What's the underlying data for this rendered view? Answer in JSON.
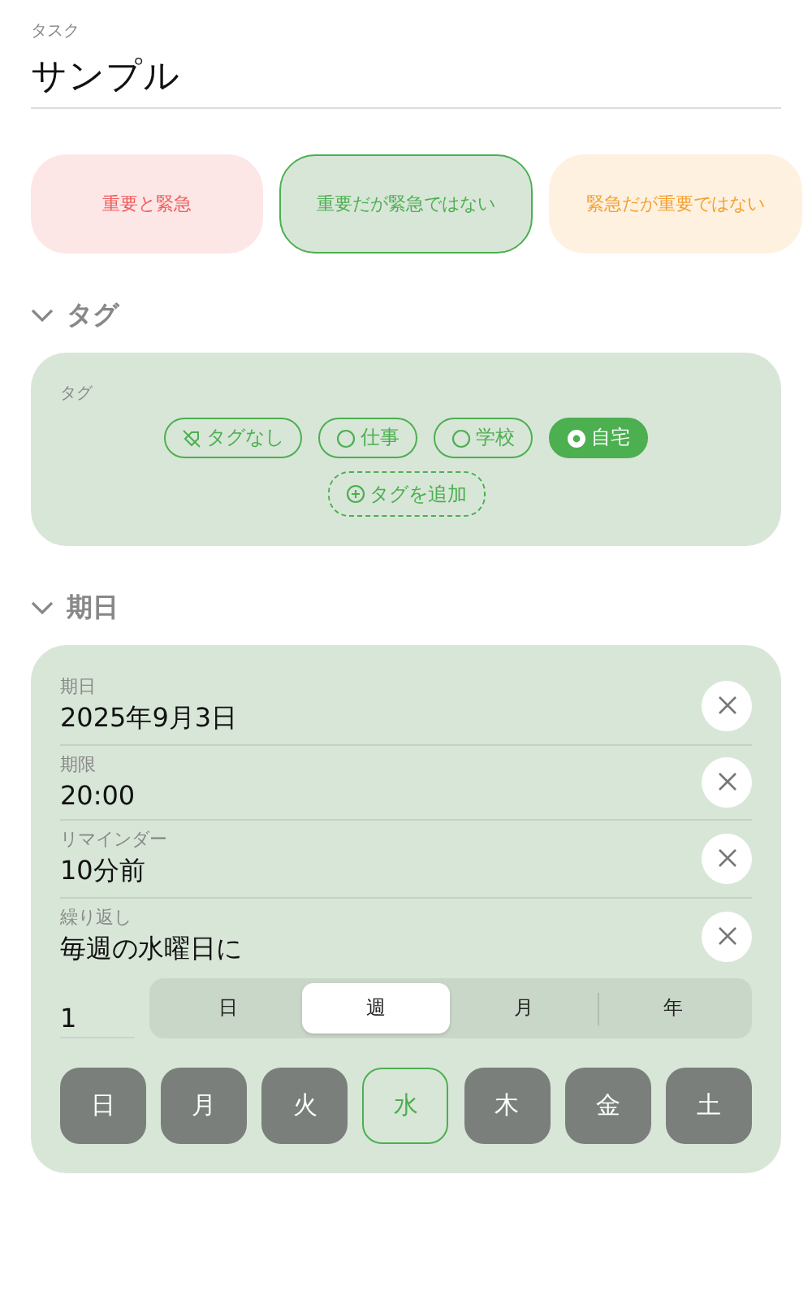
{
  "task": {
    "label": "タスク",
    "value": "サンプル"
  },
  "priorities": [
    {
      "label": "重要と緊急",
      "color": "#f05a5a",
      "selected": false
    },
    {
      "label": "重要だが緊急ではない",
      "color": "#4caf50",
      "selected": true
    },
    {
      "label": "緊急だが重要ではない",
      "color": "#f5a030",
      "selected": false
    }
  ],
  "tag_section": {
    "title": "タグ",
    "expanded": true,
    "label": "タグ",
    "tags": [
      {
        "kind": "none",
        "label": "タグなし",
        "selected": false
      },
      {
        "kind": "tag",
        "label": "仕事",
        "selected": false
      },
      {
        "kind": "tag",
        "label": "学校",
        "selected": false
      },
      {
        "kind": "tag",
        "label": "自宅",
        "selected": true
      }
    ],
    "add": {
      "label": "タグを追加"
    }
  },
  "due_section": {
    "title": "期日",
    "expanded": true,
    "fields": [
      {
        "label": "期日",
        "value": "2025年9月3日"
      },
      {
        "label": "期限",
        "value": "20:00"
      },
      {
        "label": "リマインダー",
        "value": "10分前"
      },
      {
        "label": "繰り返し",
        "value": "毎週の水曜日に"
      }
    ],
    "interval": "1",
    "units": [
      {
        "label": "日",
        "selected": false
      },
      {
        "label": "週",
        "selected": true
      },
      {
        "label": "月",
        "selected": false
      },
      {
        "label": "年",
        "selected": false
      }
    ],
    "weekdays": [
      {
        "label": "日",
        "selected": false
      },
      {
        "label": "月",
        "selected": false
      },
      {
        "label": "火",
        "selected": false
      },
      {
        "label": "水",
        "selected": true
      },
      {
        "label": "木",
        "selected": false
      },
      {
        "label": "金",
        "selected": false
      },
      {
        "label": "土",
        "selected": false
      }
    ]
  }
}
